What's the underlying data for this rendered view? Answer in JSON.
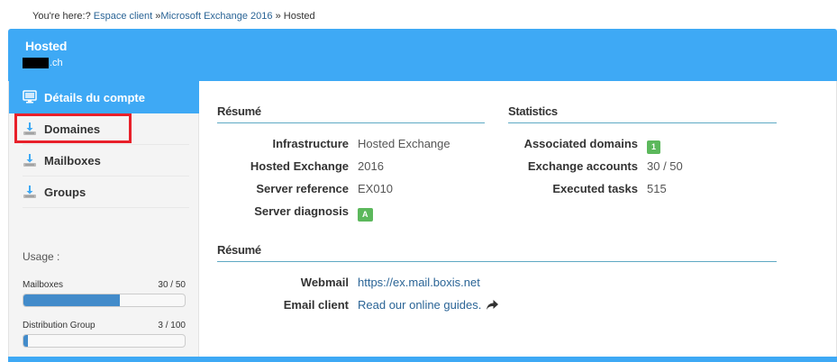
{
  "breadcrumb": {
    "prefix": "You're here:?",
    "items": [
      "Espace client",
      "Microsoft Exchange 2016",
      "Hosted"
    ],
    "sep1": "»",
    "sep2": "»"
  },
  "header": {
    "title": "Hosted",
    "subtitle_suffix": ".ch"
  },
  "sidebar": {
    "active": {
      "label": "Détails du compte",
      "icon": "monitor-icon"
    },
    "items": [
      {
        "label": "Domaines",
        "icon": "download-icon"
      },
      {
        "label": "Mailboxes",
        "icon": "download-icon"
      },
      {
        "label": "Groups",
        "icon": "download-icon"
      }
    ],
    "usage": {
      "title": "Usage :",
      "meters": [
        {
          "label": "Mailboxes",
          "value": "30 / 50",
          "fraction": 0.6
        },
        {
          "label": "Distribution Group",
          "value": "3 / 100",
          "fraction": 0.03
        }
      ]
    }
  },
  "summary": {
    "title": "Résumé",
    "rows": [
      {
        "label": "Infrastructure",
        "value": "Hosted Exchange"
      },
      {
        "label": "Hosted Exchange",
        "value": "2016"
      },
      {
        "label": "Server reference",
        "value": "EX010"
      },
      {
        "label": "Server diagnosis",
        "badge": "A"
      }
    ]
  },
  "statistics": {
    "title": "Statistics",
    "rows": [
      {
        "label": "Associated domains",
        "badge": "1"
      },
      {
        "label": "Exchange accounts",
        "value": "30 / 50"
      },
      {
        "label": "Executed tasks",
        "value": "515"
      }
    ]
  },
  "access": {
    "title": "Résumé",
    "rows": [
      {
        "label": "Webmail",
        "link": "https://ex.mail.boxis.net"
      },
      {
        "label": "Email client",
        "link": "Read our online guides.",
        "icon": "share-arrow-icon"
      }
    ]
  },
  "colors": {
    "accent": "#3ea9f5",
    "highlight": "#e8202a",
    "badge": "#5cb85c",
    "link": "#2a6496",
    "bar": "#428bca"
  }
}
